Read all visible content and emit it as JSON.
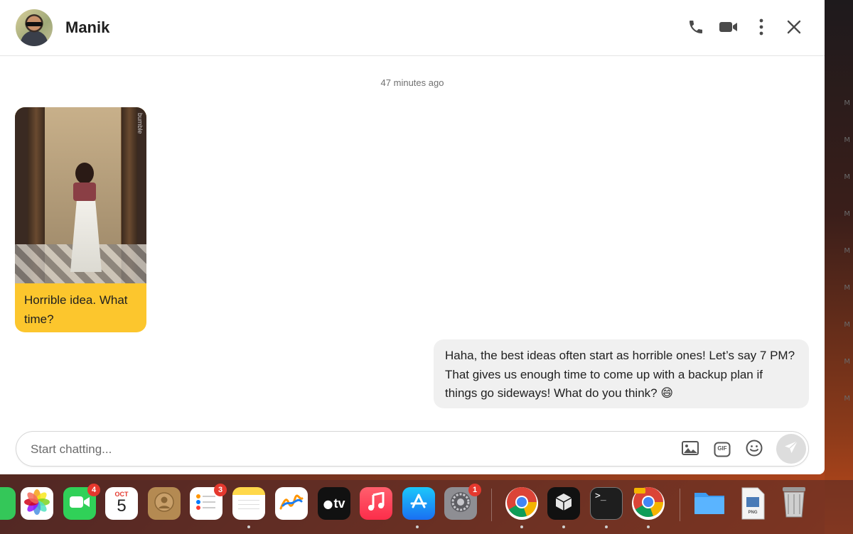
{
  "header": {
    "contact_name": "Manik",
    "actions": [
      {
        "name": "phone-icon"
      },
      {
        "name": "video-camera-icon"
      },
      {
        "name": "more-options-icon"
      },
      {
        "name": "close-icon"
      }
    ]
  },
  "conversation": {
    "timestamp": "47 minutes ago",
    "messages": [
      {
        "direction": "incoming",
        "has_image": true,
        "text": "Horrible idea. What time?"
      },
      {
        "direction": "outgoing",
        "text": "Haha, the best ideas often start as horrible ones! Let’s say 7 PM? That gives us enough time to come up with a backup plan if things go sideways! What do you think? 😄"
      }
    ],
    "image_watermark": "bumble"
  },
  "composer": {
    "placeholder": "Start chatting...",
    "value": "",
    "tools": [
      "image-icon",
      "gif-icon",
      "emoji-icon",
      "send-icon"
    ],
    "gif_label": "GIF"
  },
  "dock": {
    "calendar_month": "OCT",
    "calendar_day": "5",
    "appletv_label": "tv",
    "file_label": "PNG",
    "badges": {
      "facetime": "4",
      "reminders": "3",
      "settings": "1"
    }
  },
  "colors": {
    "incoming_bubble": "#fcc62d",
    "outgoing_bubble": "#f0f0f0",
    "badge": "#e5382e"
  }
}
